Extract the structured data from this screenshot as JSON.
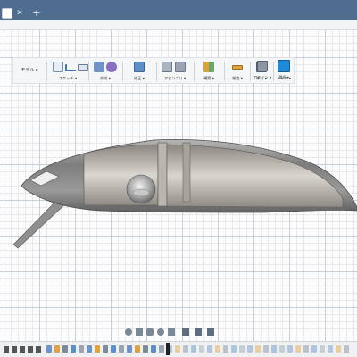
{
  "ribbon": {
    "workspace_label": "モデル ▾",
    "groups": [
      {
        "label": "スケッチ ▾"
      },
      {
        "label": "作成 ▾"
      },
      {
        "label": "修正 ▾"
      },
      {
        "label": "アセンブリ ▾"
      },
      {
        "label": "構築 ▾"
      },
      {
        "label": "検査 ▾"
      },
      {
        "label": "挿入 ▾"
      },
      {
        "label": "メイク ▾"
      },
      {
        "label": "アドイン ▾"
      },
      {
        "label": "選択 ▾"
      }
    ]
  },
  "colors": {
    "titlebar": "#4f6d8f",
    "accent_select": "#1c8ad6",
    "grid_major": "#c9cfd6",
    "grid_minor": "#e6e9ed",
    "model_body": "#8c8c8c"
  },
  "icons": {
    "sketch": [
      "create-sketch-icon",
      "line-icon",
      "rectangle-icon"
    ],
    "create": [
      "extrude-icon",
      "form-icon"
    ],
    "modify": [
      "press-pull-icon"
    ],
    "assemble": [
      "joint-icon"
    ],
    "construct": [
      "plane-icon"
    ],
    "inspect": [
      "measure-icon"
    ],
    "insert": [
      "insert-image-icon"
    ],
    "make": [
      "3d-print-icon"
    ],
    "addins": [
      "scripts-icon"
    ],
    "select": [
      "select-cursor-icon"
    ]
  }
}
